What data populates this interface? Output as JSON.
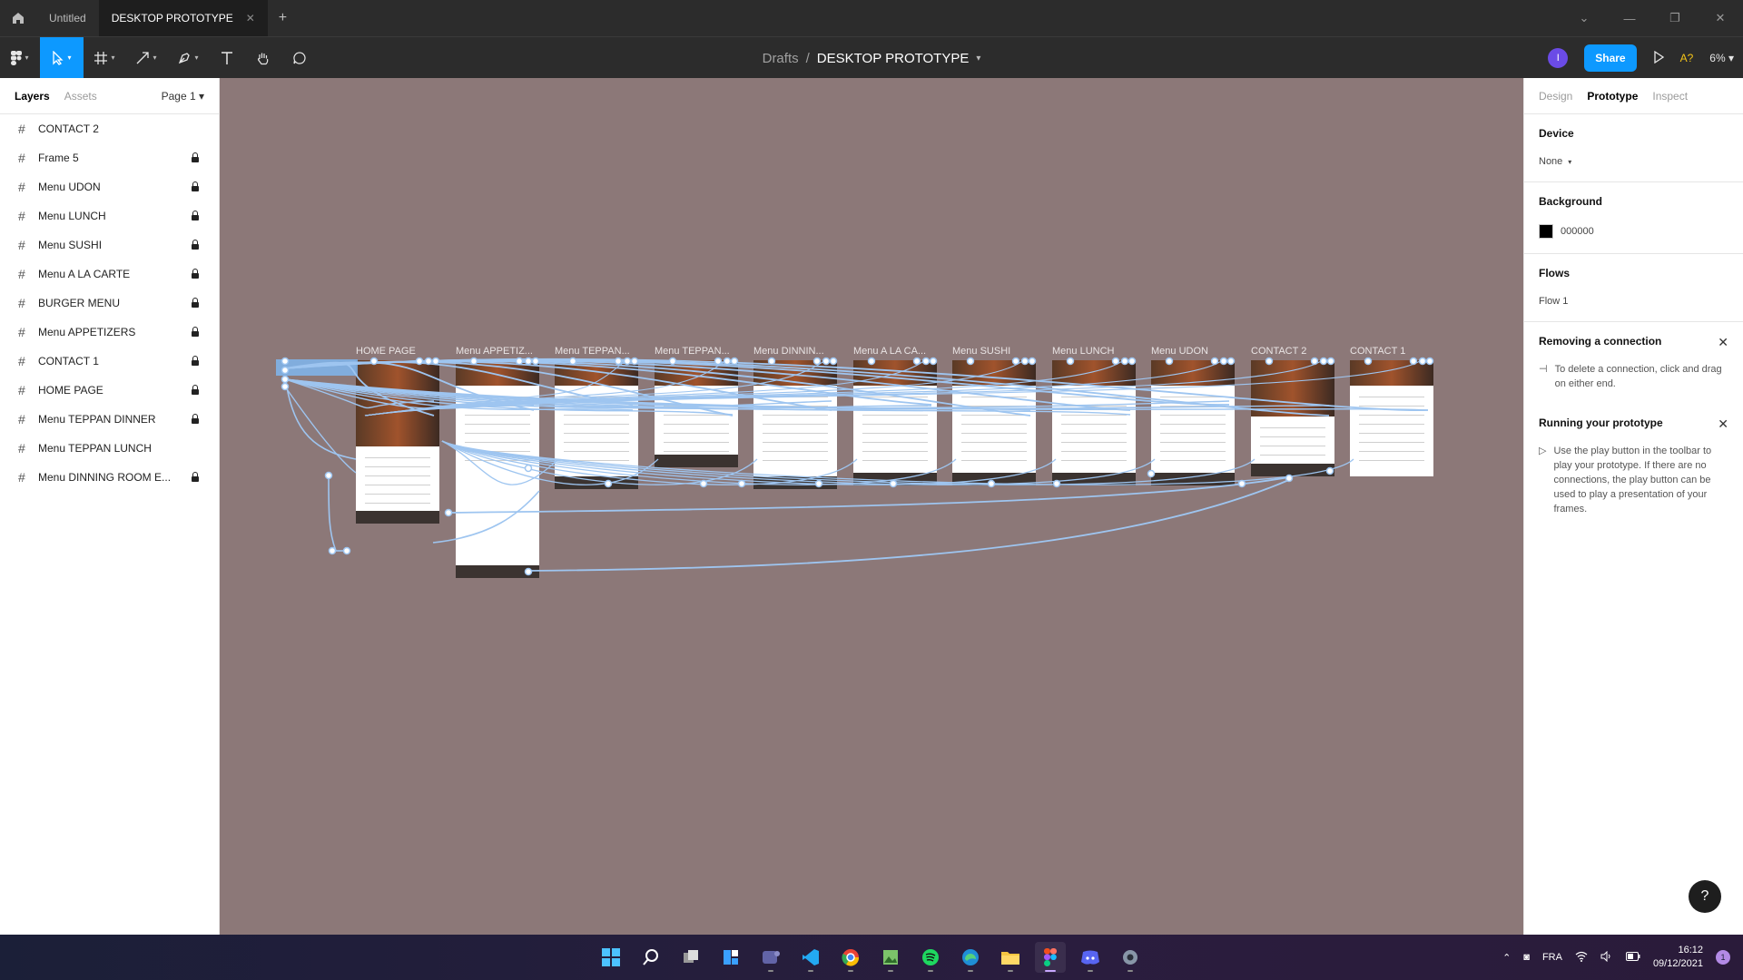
{
  "titlebar": {
    "tabs": [
      {
        "label": "Untitled",
        "active": false
      },
      {
        "label": "DESKTOP PROTOTYPE",
        "active": true
      }
    ],
    "new_tab": "+",
    "controls": [
      "⌄",
      "—",
      "❐",
      "✕"
    ]
  },
  "toolbar": {
    "breadcrumb_parent": "Drafts",
    "breadcrumb_sep": "/",
    "file_name": "DESKTOP PROTOTYPE",
    "avatar_initial": "I",
    "share_label": "Share",
    "a11y_label": "A?",
    "zoom": "6%"
  },
  "left_panel": {
    "tab_layers": "Layers",
    "tab_assets": "Assets",
    "page": "Page 1",
    "layers": [
      {
        "name": "CONTACT 2",
        "locked": false
      },
      {
        "name": "Frame 5",
        "locked": true
      },
      {
        "name": "Menu UDON",
        "locked": true
      },
      {
        "name": "Menu LUNCH",
        "locked": true
      },
      {
        "name": "Menu SUSHI",
        "locked": true
      },
      {
        "name": "Menu A LA CARTE",
        "locked": true
      },
      {
        "name": "BURGER MENU",
        "locked": true
      },
      {
        "name": "Menu APPETIZERS",
        "locked": true
      },
      {
        "name": "CONTACT 1",
        "locked": true
      },
      {
        "name": "HOME PAGE",
        "locked": true
      },
      {
        "name": "Menu TEPPAN DINNER",
        "locked": true
      },
      {
        "name": "Menu TEPPAN LUNCH",
        "locked": false
      },
      {
        "name": "Menu DINNING ROOM E...",
        "locked": true
      }
    ]
  },
  "canvas": {
    "background": "#8c7878",
    "frame_labels": [
      "HOME PAGE",
      "Menu APPETIZ...",
      "Menu TEPPAN...",
      "Menu TEPPAN...",
      "Menu DINNIN...",
      "Menu A LA CA...",
      "Menu SUSHI",
      "Menu LUNCH",
      "Menu UDON",
      "CONTACT 2",
      "CONTACT 1"
    ]
  },
  "right_panel": {
    "tab_design": "Design",
    "tab_prototype": "Prototype",
    "tab_inspect": "Inspect",
    "device_title": "Device",
    "device_value": "None",
    "background_title": "Background",
    "background_value": "000000",
    "flows_title": "Flows",
    "flows_value": "Flow 1",
    "removing_title": "Removing a connection",
    "removing_body": "To delete a connection, click and drag on either end.",
    "running_title": "Running your prototype",
    "running_body": "Use the play button in the toolbar to play your prototype. If there are no connections, the play button can be used to play a presentation of your frames.",
    "help": "?"
  },
  "taskbar": {
    "language": "FRA",
    "time": "16:12",
    "date": "09/12/2021",
    "notifications": "1",
    "apps": [
      "windows-start",
      "search",
      "task-view",
      "widgets",
      "teams",
      "vscode",
      "chrome",
      "image-editor",
      "spotify",
      "edge",
      "file-explorer",
      "figma",
      "discord",
      "settings"
    ]
  }
}
